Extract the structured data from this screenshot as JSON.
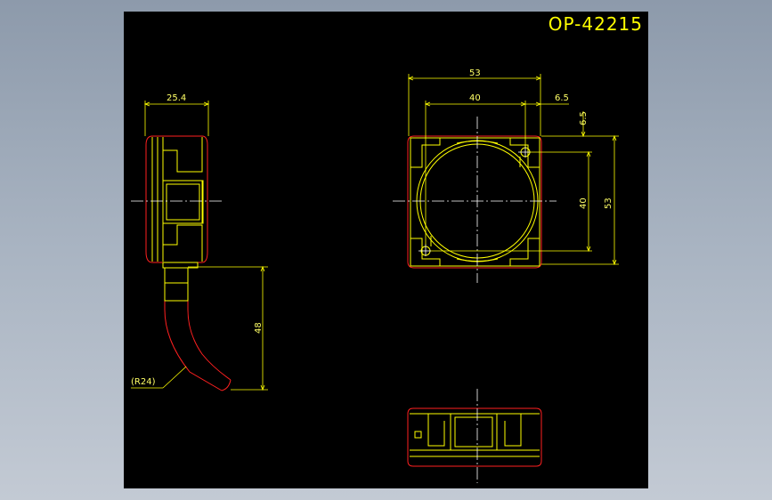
{
  "title": "OP-42215",
  "colors": {
    "background": "#000000",
    "outline": "#ff2020",
    "detail": "#ffff00",
    "centerline": "#ffffff"
  },
  "side_view": {
    "width_dim": "25.4",
    "cable_length_dim": "48",
    "bend_radius_label": "(R24)"
  },
  "front_view": {
    "overall_width_dim": "53",
    "hole_spacing_x_dim": "40",
    "edge_offset_x_dim": "6.5",
    "edge_offset_y_dim": "6.5",
    "hole_spacing_y_dim": "40",
    "overall_height_dim": "53"
  }
}
